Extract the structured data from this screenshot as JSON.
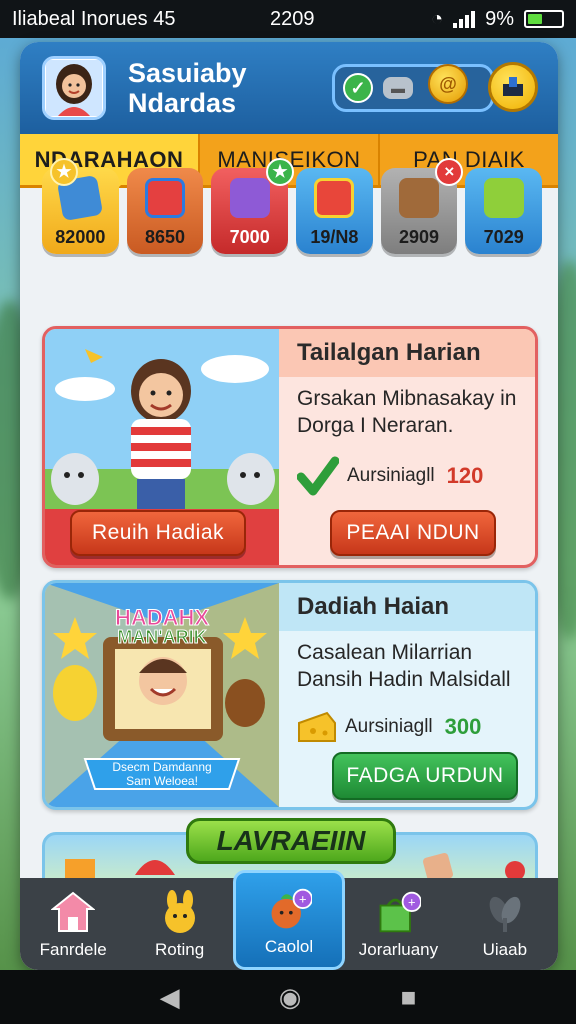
{
  "status_bar": {
    "carrier": "Iliabeal Inorues 45",
    "time": "2209",
    "battery": "9%"
  },
  "header": {
    "profile_name_line1": "Sasuiaby",
    "profile_name_line2": "Ndardas",
    "coin_symbol": "@"
  },
  "tabs": [
    {
      "label": "NDARAHAON",
      "active": true
    },
    {
      "label": "MANISEIKON",
      "active": false
    },
    {
      "label": "PAN DIAIK",
      "active": false
    }
  ],
  "items": [
    {
      "value": "82000",
      "color": "#f6c22a",
      "badge": ""
    },
    {
      "value": "8650",
      "color": "#e8753a",
      "badge": ""
    },
    {
      "value": "7000",
      "color": "#e64848",
      "badge": "★"
    },
    {
      "value": "19/N8",
      "color": "#3ea2e8",
      "badge": ""
    },
    {
      "value": "2909",
      "color": "#9b9b9b",
      "badge": "×"
    },
    {
      "value": "7029",
      "color": "#3ea2e8",
      "badge": ""
    }
  ],
  "cards": [
    {
      "title": "Tailalgan Harian",
      "desc_line1": "Grsakan Mibnasakay in",
      "desc_line2": "Dorga I Neraran.",
      "reward_label": "Aursiniagll",
      "reward_value": "120",
      "reward_color": "#d23a2a",
      "left_button": "Reuih Hadiak",
      "right_button": "PEAAI NDUN"
    },
    {
      "title": "Dadiah Haian",
      "desc_line1": "Casalean Milarrian",
      "desc_line2": "Dansih Hadin Malsidall",
      "reward_label": "Aursiniagll",
      "reward_value": "300",
      "reward_color": "#2e9e3a",
      "image_title_line1": "HADAHX",
      "image_title_line2": "MAN'ARIK",
      "image_ribbon_line1": "Dsecm Damdanng",
      "image_ribbon_line2": "Sam Weloea!",
      "right_button": "FADGA URDUN"
    }
  ],
  "banner": {
    "label": "LAVRAEIIN"
  },
  "bottom_nav": [
    {
      "label": "Fanrdele",
      "icon": "house-icon",
      "active": false
    },
    {
      "label": "Roting",
      "icon": "bunny-icon",
      "active": false
    },
    {
      "label": "Caolol",
      "icon": "fruit-icon",
      "active": true
    },
    {
      "label": "Jorarluany",
      "icon": "bag-icon",
      "active": false
    },
    {
      "label": "Uiaab",
      "icon": "leaf-icon",
      "active": false
    }
  ],
  "colors": {
    "accent": "#1d5f9f",
    "tab_bar": "#f3a21b",
    "active_tab": "#ffd43a"
  }
}
